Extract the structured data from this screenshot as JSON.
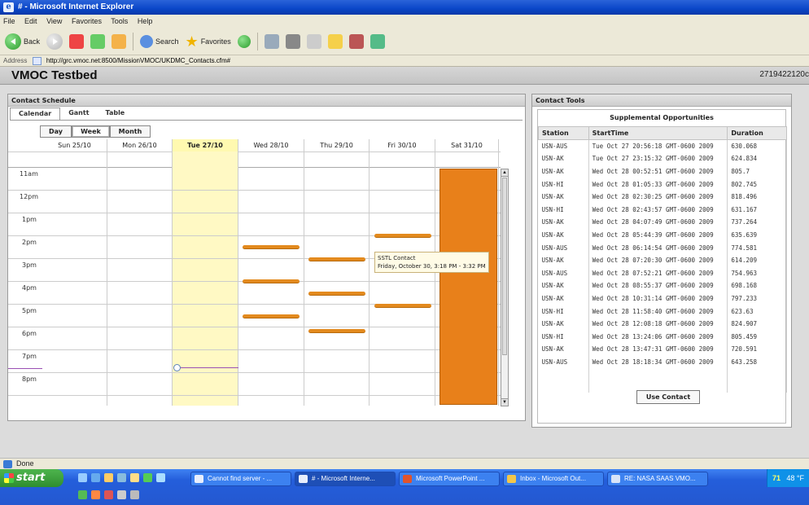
{
  "window": {
    "title": "# - Microsoft Internet Explorer"
  },
  "menu": [
    "File",
    "Edit",
    "View",
    "Favorites",
    "Tools",
    "Help"
  ],
  "toolbar": {
    "back_label": "Back",
    "search_label": "Search",
    "favorites_label": "Favorites"
  },
  "address": {
    "label": "Address",
    "url": "http://grc.vmoc.net:8500/MissionVMOC/UKDMC_Contacts.cfm#"
  },
  "app": {
    "title": "VMOC Testbed",
    "code": "2719422120c"
  },
  "contact_schedule": {
    "title": "Contact Schedule",
    "tabs": [
      "Calendar",
      "Gantt",
      "Table"
    ],
    "views": [
      "Day",
      "Week",
      "Month"
    ],
    "days": [
      "Sun 25/10",
      "Mon 26/10",
      "Tue 27/10",
      "Wed 28/10",
      "Thu 29/10",
      "Fri 30/10",
      "Sat 31/10"
    ],
    "hours": [
      "11am",
      "12pm",
      "1pm",
      "2pm",
      "3pm",
      "4pm",
      "5pm",
      "6pm",
      "7pm",
      "8pm"
    ],
    "tooltip": {
      "line1": "SSTL Contact",
      "line2": "Friday, October 30, 3:18 PM - 3:32 PM"
    }
  },
  "contact_tools": {
    "title": "Contact Tools",
    "supp_title": "Supplemental Opportunities",
    "columns": [
      "Station",
      "StartTime",
      "Duration"
    ],
    "rows": [
      [
        "USN-AUS",
        "Tue Oct 27 20:56:18 GMT-0600 2009",
        "630.068"
      ],
      [
        "USN-AK",
        "Tue Oct 27 23:15:32 GMT-0600 2009",
        "624.834"
      ],
      [
        "USN-AK",
        "Wed Oct 28 00:52:51 GMT-0600 2009",
        "805.7"
      ],
      [
        "USN-HI",
        "Wed Oct 28 01:05:33 GMT-0600 2009",
        "802.745"
      ],
      [
        "USN-AK",
        "Wed Oct 28 02:30:25 GMT-0600 2009",
        "818.496"
      ],
      [
        "USN-HI",
        "Wed Oct 28 02:43:57 GMT-0600 2009",
        "631.167"
      ],
      [
        "USN-AK",
        "Wed Oct 28 04:07:49 GMT-0600 2009",
        "737.264"
      ],
      [
        "USN-AK",
        "Wed Oct 28 05:44:39 GMT-0600 2009",
        "635.639"
      ],
      [
        "USN-AUS",
        "Wed Oct 28 06:14:54 GMT-0600 2009",
        "774.581"
      ],
      [
        "USN-AK",
        "Wed Oct 28 07:20:30 GMT-0600 2009",
        "614.209"
      ],
      [
        "USN-AUS",
        "Wed Oct 28 07:52:21 GMT-0600 2009",
        "754.963"
      ],
      [
        "USN-AK",
        "Wed Oct 28 08:55:37 GMT-0600 2009",
        "698.168"
      ],
      [
        "USN-AK",
        "Wed Oct 28 10:31:14 GMT-0600 2009",
        "797.233"
      ],
      [
        "USN-HI",
        "Wed Oct 28 11:58:40 GMT-0600 2009",
        "623.63"
      ],
      [
        "USN-AK",
        "Wed Oct 28 12:08:18 GMT-0600 2009",
        "824.907"
      ],
      [
        "USN-HI",
        "Wed Oct 28 13:24:06 GMT-0600 2009",
        "805.459"
      ],
      [
        "USN-AK",
        "Wed Oct 28 13:47:31 GMT-0600 2009",
        "720.591"
      ],
      [
        "USN-AUS",
        "Wed Oct 28 18:18:34 GMT-0600 2009",
        "643.258"
      ]
    ],
    "use_button": "Use Contact"
  },
  "status": {
    "text": "Done"
  },
  "taskbar": {
    "start": "start",
    "tasks": [
      "Cannot find server - ...",
      "# - Microsoft Interne...",
      "Microsoft PowerPoint ...",
      "Inbox - Microsoft Out...",
      "RE: NASA SAAS VMO..."
    ],
    "tray_temp": "48 °F",
    "tray_widget": "71"
  }
}
